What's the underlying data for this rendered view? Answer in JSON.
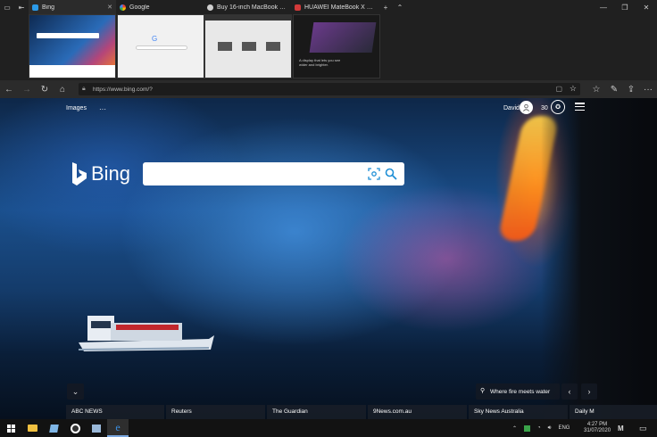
{
  "tabs": [
    {
      "title": "Bing",
      "active": true,
      "favicon_color": "#2b9ae8"
    },
    {
      "title": "Google",
      "active": false,
      "favicon_color": "#e0e0e0"
    },
    {
      "title": "Buy 16-inch MacBook Pro -",
      "active": false,
      "favicon_color": "#cfcfcf"
    },
    {
      "title": "HUAWEI MateBook X Pro 2I",
      "active": false,
      "favicon_color": "#d23a3a"
    }
  ],
  "previews": {
    "huawei_text": "A display that lets you see wider and brighter."
  },
  "address": {
    "url": "https://www.bing.com/?"
  },
  "bing": {
    "nav_images": "Images",
    "nav_more": "···",
    "logo_text": "Bing",
    "search_placeholder": "",
    "user_name": "David",
    "rewards_points": "30",
    "caption": "Where fire meets water"
  },
  "news": [
    "ABC NEWS",
    "Reuters",
    "The Guardian",
    "9News.com.au",
    "Sky News Australia",
    "Daily M"
  ],
  "tray": {
    "lang": "ENG",
    "time": "4:27 PM",
    "date": "31/07/2020"
  },
  "colors": {
    "accent": "#0078d4",
    "bing_teal": "#1f8fd6"
  }
}
